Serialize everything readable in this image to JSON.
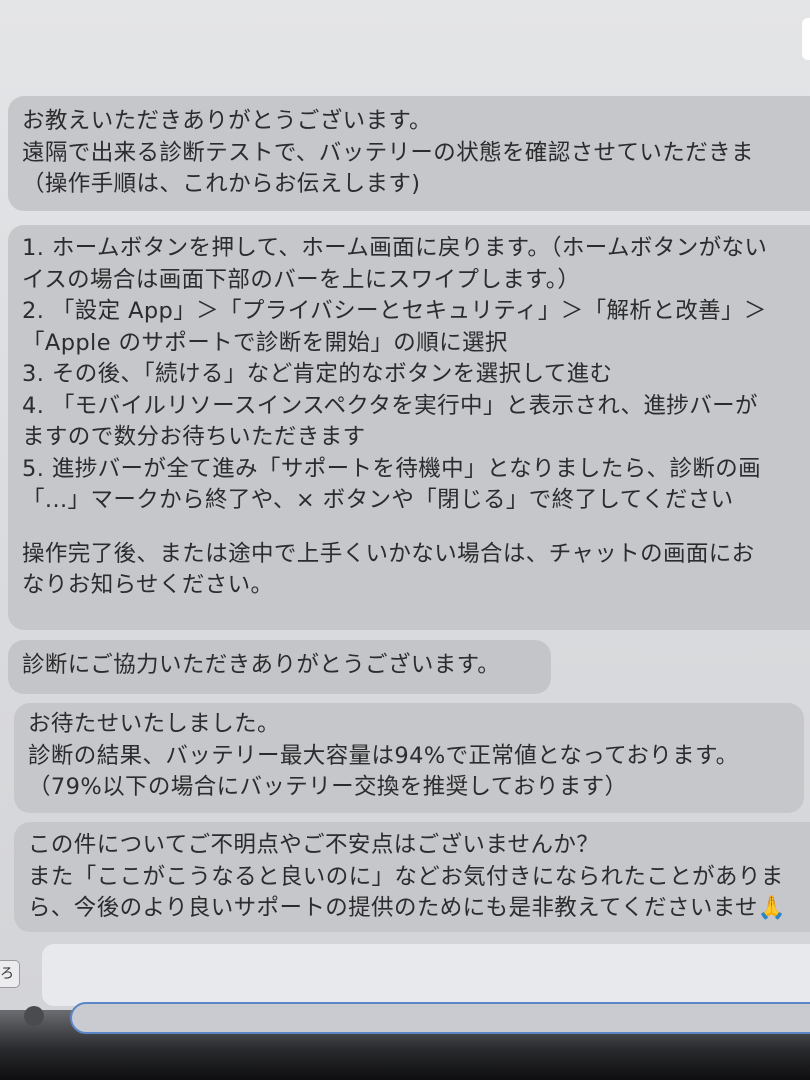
{
  "messages": [
    {
      "lines": [
        "お教えいただきありがとうございます。",
        "遠隔で出来る診断テストで、バッテリーの状態を確認させていただきま",
        "（操作手順は、これからお伝えします)"
      ]
    },
    {
      "lines": [
        "1. ホームボタンを押して、ホーム画面に戻ります。（ホームボタンがない",
        "イスの場合は画面下部のバーを上にスワイプします。）",
        "2. 「設定 App」＞「プライバシーとセキュリティ」＞「解析と改善」＞",
        "「Apple のサポートで診断を開始」の順に選択",
        "3. その後、「続ける」など肯定的なボタンを選択して進む",
        "4. 「モバイルリソースインスペクタを実行中」と表示され、進捗バーが",
        "ますので数分お待ちいただきます",
        "5. 進捗バーが全て進み「サポートを待機中」となりましたら、診断の画",
        "「...」マークから終了や、× ボタンや「閉じる」で終了してください"
      ],
      "lines_after_gap": [
        "操作完了後、または途中で上手くいかない場合は、チャットの画面にお",
        "なりお知らせください。"
      ]
    },
    {
      "lines": [
        "診断にご協力いただきありがとうございます。"
      ]
    },
    {
      "lines": [
        "お待たせいたしました。",
        "診断の結果、バッテリー最大容量は94%で正常値となっております。",
        "（79%以下の場合にバッテリー交換を推奨しております）"
      ]
    },
    {
      "lines": [
        "この件についてご不明点やご不安点はございませんか？",
        "また「ここがこうなると良いのに」などお気付きになられたことがありま",
        "ら、今後のより良いサポートの提供のためにも是非教えてくださいませ🙏"
      ]
    }
  ],
  "composer": {
    "left_button_label": "ろ"
  },
  "colors": {
    "bubble": "#c6c7cb",
    "text": "#2c2c2e",
    "background": "#dcdde0",
    "input_border": "#5a86c8"
  }
}
